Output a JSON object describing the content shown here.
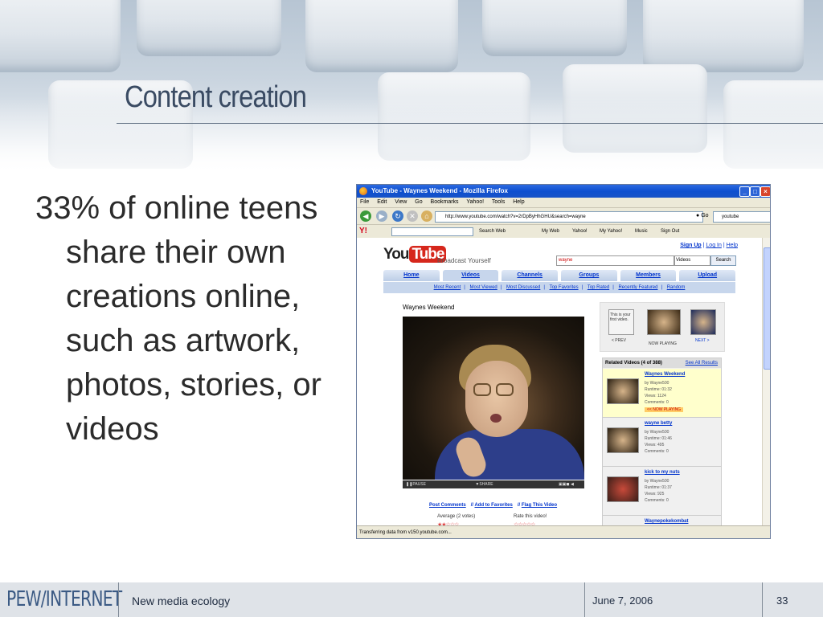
{
  "slide": {
    "title": "Content creation",
    "bullet": "33% of online teens share their own creations online, such as artwork, photos, stories, or videos"
  },
  "footer": {
    "logo": "PEW/INTERNET",
    "subtitle": "New media ecology",
    "date": "June 7, 2006",
    "page": "33"
  },
  "browser": {
    "title": "YouTube - Waynes Weekend - Mozilla Firefox",
    "menu": [
      "File",
      "Edit",
      "View",
      "Go",
      "Bookmarks",
      "Yahoo!",
      "Tools",
      "Help"
    ],
    "url": "http://www.youtube.com/watch?v=2rDpByHhGHU&search=wayne",
    "go_label": "Go",
    "search_value": "youtube",
    "yahoo_toolbar": [
      "Search Web",
      "My Web",
      "Yahoo!",
      "My Yahoo!",
      "Music",
      "Sign Out"
    ],
    "status": "Transferring data from v150.youtube.com..."
  },
  "youtube": {
    "logo_you": "You",
    "logo_tube": "Tube",
    "slogan": "Broadcast Yourself",
    "top_links": [
      "Sign Up",
      "Log In",
      "Help"
    ],
    "search_value": "wayne",
    "search_select": "Videos",
    "search_button": "Search",
    "tabs": [
      "Home",
      "Videos",
      "Channels",
      "Groups",
      "Members",
      "Upload"
    ],
    "subnav": [
      "Most Recent",
      "Most Viewed",
      "Most Discussed",
      "Top Favorites",
      "Top Rated",
      "Recently Featured",
      "Random"
    ],
    "video_title": "Waynes Weekend",
    "controls": {
      "pause": "PAUSE",
      "share": "SHARE"
    },
    "actions": [
      "Post Comments",
      "Add to Favorites",
      "Flag This Video"
    ],
    "rating_label": "Average (2 votes)",
    "rate_label": "Rate this video!",
    "strip": {
      "first_text": "This is your first video.",
      "prev": "< PREV",
      "now_playing": "NOW PLAYING",
      "next": "NEXT >"
    },
    "related_header": "Related Videos (4 of 388)",
    "see_all": "See All Results",
    "related": [
      {
        "title": "Waynes Weekend",
        "by": "by Wayne500",
        "runtime": "Runtime: 01:32",
        "views": "Views: 1124",
        "comments": "Comments: 0",
        "now_playing": "<< NOW PLAYING"
      },
      {
        "title": "wayne betty",
        "by": "by Wayne500",
        "runtime": "Runtime: 01:46",
        "views": "Views: 495",
        "comments": "Comments: 0"
      },
      {
        "title": "kick to my nuts",
        "by": "by Wayne500",
        "runtime": "Runtime: 01:37",
        "views": "Views: 925",
        "comments": "Comments: 0"
      },
      {
        "title": "Waynepokekombat"
      }
    ]
  }
}
